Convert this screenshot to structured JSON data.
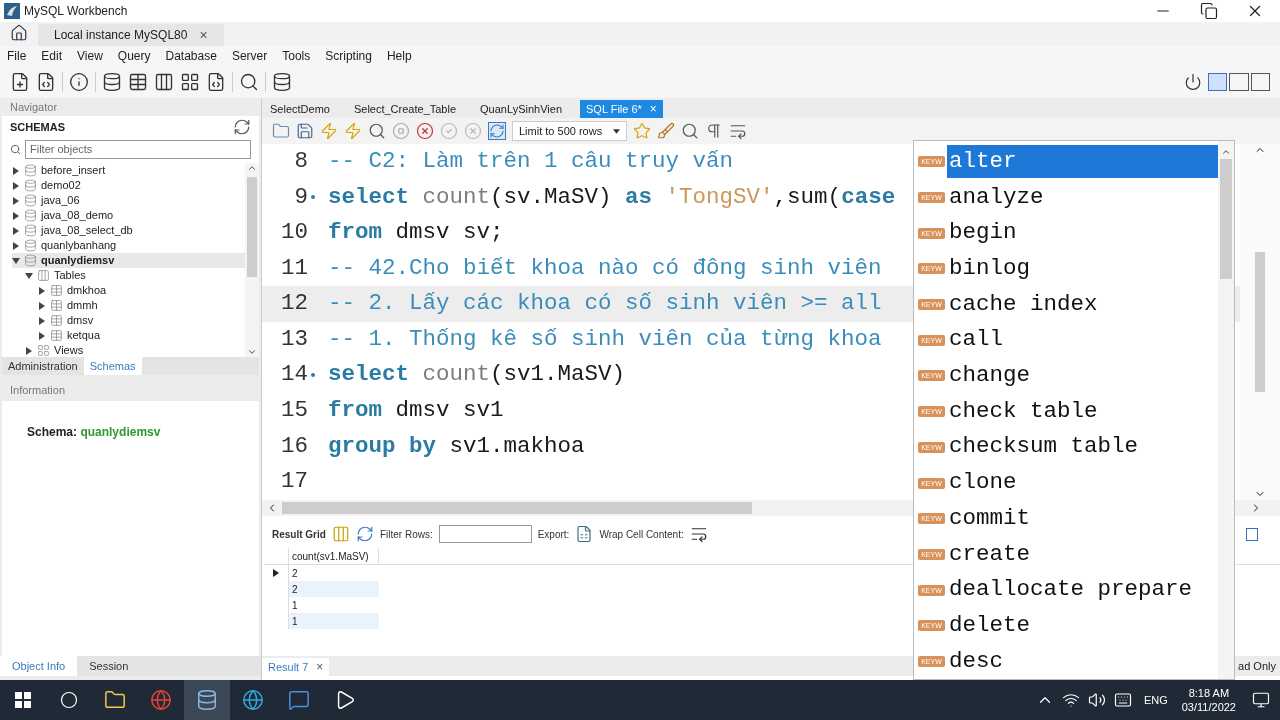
{
  "window": {
    "title": "MySQL Workbench"
  },
  "connection_tab": {
    "label": "Local instance MySQL80",
    "close": "×"
  },
  "menu": [
    "File",
    "Edit",
    "View",
    "Query",
    "Database",
    "Server",
    "Tools",
    "Scripting",
    "Help"
  ],
  "navigator": {
    "title": "Navigator",
    "schemas_title": "SCHEMAS",
    "filter_placeholder": "Filter objects",
    "tree": [
      {
        "label": "before_insert",
        "kind": "schema",
        "expanded": false,
        "selected": false
      },
      {
        "label": "demo02",
        "kind": "schema",
        "expanded": false,
        "selected": false
      },
      {
        "label": "java_06",
        "kind": "schema",
        "expanded": false,
        "selected": false
      },
      {
        "label": "java_08_demo",
        "kind": "schema",
        "expanded": false,
        "selected": false
      },
      {
        "label": "java_08_select_db",
        "kind": "schema",
        "expanded": false,
        "selected": false
      },
      {
        "label": "quanlybanhang",
        "kind": "schema",
        "expanded": false,
        "selected": false
      },
      {
        "label": "quanlydiemsv",
        "kind": "schema",
        "expanded": true,
        "selected": true,
        "children": [
          {
            "label": "Tables",
            "kind": "folder",
            "expanded": true,
            "selected": false,
            "children": [
              {
                "label": "dmkhoa",
                "kind": "table",
                "expanded": false,
                "selected": false
              },
              {
                "label": "dmmh",
                "kind": "table",
                "expanded": false,
                "selected": false
              },
              {
                "label": "dmsv",
                "kind": "table",
                "expanded": false,
                "selected": false
              },
              {
                "label": "ketqua",
                "kind": "table",
                "expanded": false,
                "selected": false
              }
            ]
          },
          {
            "label": "Views",
            "kind": "view_folder",
            "expanded": false,
            "selected": false
          }
        ]
      }
    ]
  },
  "panel_tabs": [
    {
      "label": "Administration",
      "selected": false
    },
    {
      "label": "Schemas",
      "selected": true
    }
  ],
  "information": {
    "title": "Information",
    "label": "Schema:",
    "value": "quanlydiemsv"
  },
  "bottom_tabs": [
    {
      "label": "Object Info",
      "selected": true
    },
    {
      "label": "Session",
      "selected": false
    }
  ],
  "editor_tabs": [
    {
      "label": "SelectDemo",
      "selected": false
    },
    {
      "label": "Select_Create_Table",
      "selected": false
    },
    {
      "label": "QuanLySinhVien",
      "selected": false
    },
    {
      "label": "SQL File 6*",
      "selected": true,
      "close": "×"
    }
  ],
  "editor_toolbar": {
    "limit": "Limit to 500 rows"
  },
  "code_lines": [
    {
      "number": "8",
      "marker": false,
      "current": false,
      "tokens": [
        {
          "kind": "comment",
          "text": "-- C2: Làm trên 1 câu truy vấn"
        }
      ]
    },
    {
      "number": "9",
      "marker": true,
      "current": false,
      "tokens": [
        {
          "kind": "keyword",
          "text": "select "
        },
        {
          "kind": "function",
          "text": "count"
        },
        {
          "kind": "plain",
          "text": "(sv.MaSV) "
        },
        {
          "kind": "keyword",
          "text": "as "
        },
        {
          "kind": "string",
          "text": "'TongSV'"
        },
        {
          "kind": "plain",
          "text": ",sum("
        },
        {
          "kind": "keyword",
          "text": "case"
        }
      ]
    },
    {
      "number": "10",
      "marker": false,
      "current": false,
      "tokens": [
        {
          "kind": "keyword",
          "text": "from"
        },
        {
          "kind": "plain",
          "text": " dmsv sv;"
        }
      ]
    },
    {
      "number": "11",
      "marker": false,
      "current": false,
      "tokens": [
        {
          "kind": "comment",
          "text": "-- 42.Cho biết khoa nào có đông sinh viên"
        }
      ]
    },
    {
      "number": "12",
      "marker": false,
      "current": true,
      "tokens": [
        {
          "kind": "comment",
          "text": "-- 2. Lấy các khoa có số sinh viên >= all"
        }
      ]
    },
    {
      "number": "13",
      "marker": false,
      "current": false,
      "tokens": [
        {
          "kind": "comment",
          "text": "-- 1. Thống kê số sinh viên của từng khoa"
        }
      ]
    },
    {
      "number": "14",
      "marker": true,
      "current": false,
      "tokens": [
        {
          "kind": "keyword",
          "text": "select "
        },
        {
          "kind": "function",
          "text": "count"
        },
        {
          "kind": "plain",
          "text": "(sv1.MaSV)"
        }
      ]
    },
    {
      "number": "15",
      "marker": false,
      "current": false,
      "tokens": [
        {
          "kind": "keyword",
          "text": "from"
        },
        {
          "kind": "plain",
          "text": " dmsv sv1"
        }
      ]
    },
    {
      "number": "16",
      "marker": false,
      "current": false,
      "tokens": [
        {
          "kind": "keyword",
          "text": "group by"
        },
        {
          "kind": "plain",
          "text": " sv1.makhoa"
        }
      ]
    },
    {
      "number": "17",
      "marker": false,
      "current": false
    }
  ],
  "result": {
    "grid_label": "Result Grid",
    "filter_label": "Filter Rows:",
    "export_label": "Export:",
    "wrap_label": "Wrap Cell Content:",
    "columns": [
      "count(sv1.MaSV)"
    ],
    "rows": [
      {
        "cells": [
          "2"
        ],
        "selected": true
      },
      {
        "cells": [
          "2"
        ],
        "selected": false
      },
      {
        "cells": [
          "1"
        ],
        "selected": false
      },
      {
        "cells": [
          "1"
        ],
        "selected": false
      }
    ]
  },
  "result_tabs": [
    {
      "label": "Result 7",
      "close": "×"
    }
  ],
  "autocomplete": {
    "items": [
      {
        "badge": "KEYW",
        "text": "alter",
        "selected": true
      },
      {
        "badge": "KEYW",
        "text": "analyze",
        "selected": false
      },
      {
        "badge": "KEYW",
        "text": "begin",
        "selected": false
      },
      {
        "badge": "KEYW",
        "text": "binlog",
        "selected": false
      },
      {
        "badge": "KEYW",
        "text": "cache index",
        "selected": false
      },
      {
        "badge": "KEYW",
        "text": "call",
        "selected": false
      },
      {
        "badge": "KEYW",
        "text": "change",
        "selected": false
      },
      {
        "badge": "KEYW",
        "text": "check table",
        "selected": false
      },
      {
        "badge": "KEYW",
        "text": "checksum table",
        "selected": false
      },
      {
        "badge": "KEYW",
        "text": "clone",
        "selected": false
      },
      {
        "badge": "KEYW",
        "text": "commit",
        "selected": false
      },
      {
        "badge": "KEYW",
        "text": "create",
        "selected": false
      },
      {
        "badge": "KEYW",
        "text": "deallocate prepare",
        "selected": false
      },
      {
        "badge": "KEYW",
        "text": "delete",
        "selected": false
      },
      {
        "badge": "KEYW",
        "text": "desc",
        "selected": false
      }
    ]
  },
  "status": "ad Only",
  "taskbar": {
    "language": "ENG",
    "time": "8:18 AM",
    "date": "03/11/2022"
  }
}
